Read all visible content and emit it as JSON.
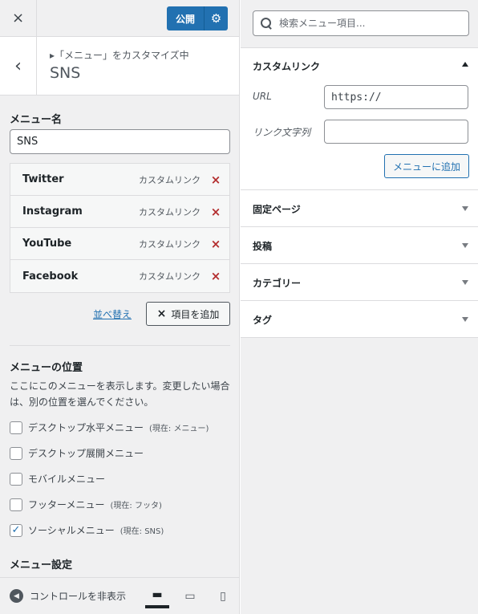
{
  "topbar": {
    "close_icon": "×",
    "publish_label": "公開",
    "settings_icon": "⚙"
  },
  "section": {
    "back_icon": "‹",
    "subtitle": "▸「メニュー」をカスタマイズ中",
    "title": "SNS"
  },
  "menu_name": {
    "label": "メニュー名",
    "value": "SNS"
  },
  "menu_items": [
    {
      "title": "Twitter",
      "type": "カスタムリンク",
      "delete_icon": "×"
    },
    {
      "title": "Instagram",
      "type": "カスタムリンク",
      "delete_icon": "×"
    },
    {
      "title": "YouTube",
      "type": "カスタムリンク",
      "delete_icon": "×"
    },
    {
      "title": "Facebook",
      "type": "カスタムリンク",
      "delete_icon": "×"
    }
  ],
  "actions": {
    "reorder_label": "並べ替え",
    "add_items_icon": "×",
    "add_items_label": "項目を追加"
  },
  "locations": {
    "title": "メニューの位置",
    "description": "ここにこのメニューを表示します。変更したい場合は、別の位置を選んでください。",
    "items": [
      {
        "label": "デスクトップ水平メニュー",
        "note": "(現在: メニュー)",
        "checked": false
      },
      {
        "label": "デスクトップ展開メニュー",
        "note": "",
        "checked": false
      },
      {
        "label": "モバイルメニュー",
        "note": "",
        "checked": false
      },
      {
        "label": "フッターメニュー",
        "note": "(現在: フッタ)",
        "checked": false
      },
      {
        "label": "ソーシャルメニュー",
        "note": "(現在: SNS)",
        "checked": true
      }
    ],
    "check_mark": "✓"
  },
  "menu_settings_label": "メニュー設定",
  "footer": {
    "collapse_icon": "◀",
    "collapse_label": "コントロールを非表示",
    "devices": [
      {
        "name": "desktop-icon",
        "glyph": "▬"
      },
      {
        "name": "tablet-icon",
        "glyph": "▭"
      },
      {
        "name": "mobile-icon",
        "glyph": "▯"
      }
    ]
  },
  "right": {
    "search_placeholder": "検索メニュー項目...",
    "custom_link": {
      "title": "カスタムリンク",
      "url_label": "URL",
      "url_value": "https://",
      "text_label": "リンク文字列",
      "text_value": "",
      "add_button": "メニューに追加"
    },
    "panels": [
      {
        "title": "固定ページ"
      },
      {
        "title": "投稿"
      },
      {
        "title": "カテゴリー"
      },
      {
        "title": "タグ"
      }
    ]
  }
}
